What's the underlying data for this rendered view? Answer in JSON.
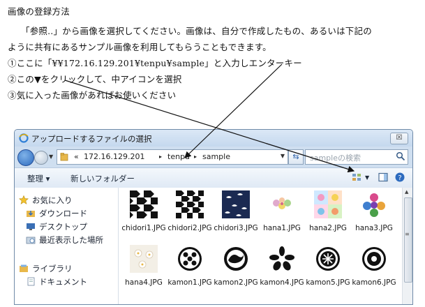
{
  "instructions": {
    "heading": "画像の登録方法",
    "para1": "「参照..」から画像を選択してください。画像は、自分で作成したもの、あるいは下記の",
    "para2": "ように共有にあるサンプル画像を利用してもらうこともできます。",
    "step1": "①ここに「¥¥172.16.129.201¥tenpu¥sample」と入力しエンターキー",
    "step2": "②この▼をクリックして、中アイコンを選択",
    "step3": "③気に入った画像があればお使いください"
  },
  "dialog": {
    "title": "アップロードするファイルの選択",
    "close_label": "☒",
    "address": {
      "prefix": "«",
      "segments": [
        "172.16.129.201",
        "tenpu",
        "sample"
      ],
      "separator": "▸"
    },
    "search_placeholder": "sampleの検索",
    "toolbar": {
      "organize": "整理 ▾",
      "new_folder": "新しいフォルダー"
    },
    "nav": {
      "favorites": "お気に入り",
      "downloads": "ダウンロード",
      "desktop": "デスクトップ",
      "recent": "最近表示した場所",
      "libraries": "ライブラリ",
      "documents": "ドキュメント"
    },
    "files": [
      {
        "name": "chidori1.JPG",
        "icon": "houndstooth-black"
      },
      {
        "name": "chidori2.JPG",
        "icon": "houndstooth-black"
      },
      {
        "name": "chidori3.JPG",
        "icon": "houndstooth-navy"
      },
      {
        "name": "hana1.JPG",
        "icon": "flowers-pastel"
      },
      {
        "name": "hana2.JPG",
        "icon": "flowers-tiles"
      },
      {
        "name": "hana3.JPG",
        "icon": "flowers-color"
      },
      {
        "name": "hana4.JPG",
        "icon": "flowers-white"
      },
      {
        "name": "kamon1.JPG",
        "icon": "crest-wisteria"
      },
      {
        "name": "kamon2.JPG",
        "icon": "crest-wave"
      },
      {
        "name": "kamon4.JPG",
        "icon": "crest-leaves"
      },
      {
        "name": "kamon5.JPG",
        "icon": "crest-circle"
      },
      {
        "name": "kamon6.JPG",
        "icon": "crest-plant"
      }
    ]
  },
  "colors": {
    "dialog_frame": "#cfdff0",
    "accent_blue": "#2d6bbf"
  }
}
